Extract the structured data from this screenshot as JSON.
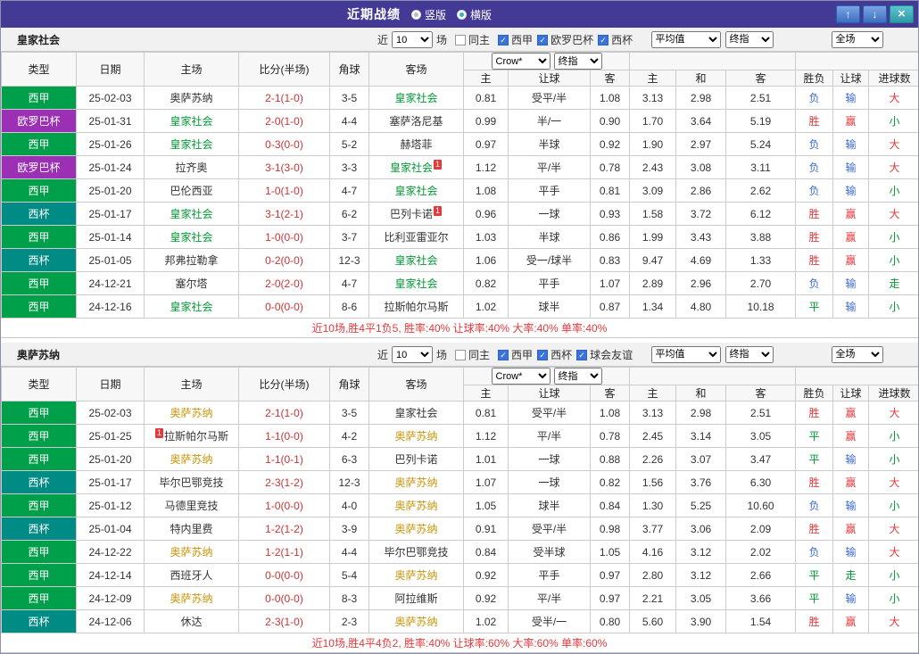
{
  "topbar": {
    "title": "近期战绩",
    "views": [
      {
        "label": "竖版",
        "selected": false
      },
      {
        "label": "横版",
        "selected": true
      }
    ],
    "up_button": "↑",
    "down_button": "↓",
    "close_button": "×",
    "bar_color": "#433a96"
  },
  "columns": {
    "type": "类型",
    "date": "日期",
    "home": "主场",
    "score": "比分(半场)",
    "corners": "角球",
    "away": "客场",
    "odds_home": "主",
    "odds_handicap": "让球",
    "odds_away": "客",
    "avg_home": "主",
    "avg_draw": "和",
    "avg_away": "客",
    "res_outcome": "胜负",
    "res_handicap": "让球",
    "res_goals": "进球数"
  },
  "league_colors": {
    "西甲": "#00a04a",
    "欧罗巴杯": "#9b30b5",
    "西杯": "#008b85"
  },
  "result_colors": {
    "胜": "#e4393c",
    "赢": "#e4393c",
    "大": "#e4393c",
    "负": "#3a6bd8",
    "输": "#3a6bd8",
    "平": "#009933",
    "走": "#009933",
    "小": "#009933"
  },
  "score_color": "#cc3333",
  "sections": [
    {
      "team": "皇家社会",
      "focal_color": "#009933",
      "filters": {
        "recent": "近",
        "count": "10",
        "games": "场",
        "same_home": "同主",
        "leagues": [
          "西甲",
          "欧罗巴杯",
          "西杯"
        ]
      },
      "selects": {
        "provider": "Crow*",
        "provider_final": "终指",
        "average": "平均值",
        "average_final": "终指",
        "scope": "全场"
      },
      "rows": [
        {
          "league": "西甲",
          "date": "25-02-03",
          "home": {
            "name": "奥萨苏纳"
          },
          "score": "2-1(1-0)",
          "corners": "3-5",
          "away": {
            "name": "皇家社会",
            "focal": true
          },
          "odds": [
            "0.81",
            "受平/半",
            "1.08"
          ],
          "avg": [
            "3.13",
            "2.98",
            "2.51"
          ],
          "results": [
            "负",
            "输",
            "大"
          ]
        },
        {
          "league": "欧罗巴杯",
          "date": "25-01-31",
          "home": {
            "name": "皇家社会",
            "focal": true
          },
          "score": "2-0(1-0)",
          "corners": "4-4",
          "away": {
            "name": "塞萨洛尼基"
          },
          "odds": [
            "0.99",
            "半/一",
            "0.90"
          ],
          "avg": [
            "1.70",
            "3.64",
            "5.19"
          ],
          "results": [
            "胜",
            "赢",
            "小"
          ]
        },
        {
          "league": "西甲",
          "date": "25-01-26",
          "home": {
            "name": "皇家社会",
            "focal": true
          },
          "score": "0-3(0-0)",
          "corners": "5-2",
          "away": {
            "name": "赫塔菲"
          },
          "odds": [
            "0.97",
            "半球",
            "0.92"
          ],
          "avg": [
            "1.90",
            "2.97",
            "5.24"
          ],
          "results": [
            "负",
            "输",
            "大"
          ]
        },
        {
          "league": "欧罗巴杯",
          "date": "25-01-24",
          "home": {
            "name": "拉齐奥"
          },
          "score": "3-1(3-0)",
          "corners": "3-3",
          "away": {
            "name": "皇家社会",
            "focal": true,
            "badge": "1",
            "badge_pos": "after"
          },
          "odds": [
            "1.12",
            "平/半",
            "0.78"
          ],
          "avg": [
            "2.43",
            "3.08",
            "3.11"
          ],
          "results": [
            "负",
            "输",
            "大"
          ]
        },
        {
          "league": "西甲",
          "date": "25-01-20",
          "home": {
            "name": "巴伦西亚"
          },
          "score": "1-0(1-0)",
          "corners": "4-7",
          "away": {
            "name": "皇家社会",
            "focal": true
          },
          "odds": [
            "1.08",
            "平手",
            "0.81"
          ],
          "avg": [
            "3.09",
            "2.86",
            "2.62"
          ],
          "results": [
            "负",
            "输",
            "小"
          ]
        },
        {
          "league": "西杯",
          "date": "25-01-17",
          "home": {
            "name": "皇家社会",
            "focal": true
          },
          "score": "3-1(2-1)",
          "corners": "6-2",
          "away": {
            "name": "巴列卡诺",
            "badge": "1",
            "badge_pos": "after"
          },
          "odds": [
            "0.96",
            "一球",
            "0.93"
          ],
          "avg": [
            "1.58",
            "3.72",
            "6.12"
          ],
          "results": [
            "胜",
            "赢",
            "大"
          ]
        },
        {
          "league": "西甲",
          "date": "25-01-14",
          "home": {
            "name": "皇家社会",
            "focal": true
          },
          "score": "1-0(0-0)",
          "corners": "3-7",
          "away": {
            "name": "比利亚雷亚尔"
          },
          "odds": [
            "1.03",
            "半球",
            "0.86"
          ],
          "avg": [
            "1.99",
            "3.43",
            "3.88"
          ],
          "results": [
            "胜",
            "赢",
            "小"
          ]
        },
        {
          "league": "西杯",
          "date": "25-01-05",
          "home": {
            "name": "邦弗拉勒拿"
          },
          "score": "0-2(0-0)",
          "corners": "12-3",
          "away": {
            "name": "皇家社会",
            "focal": true
          },
          "odds": [
            "1.06",
            "受一/球半",
            "0.83"
          ],
          "avg": [
            "9.47",
            "4.69",
            "1.33"
          ],
          "results": [
            "胜",
            "赢",
            "小"
          ]
        },
        {
          "league": "西甲",
          "date": "24-12-21",
          "home": {
            "name": "塞尔塔"
          },
          "score": "2-0(2-0)",
          "corners": "4-7",
          "away": {
            "name": "皇家社会",
            "focal": true
          },
          "odds": [
            "0.82",
            "平手",
            "1.07"
          ],
          "avg": [
            "2.89",
            "2.96",
            "2.70"
          ],
          "results": [
            "负",
            "输",
            "走"
          ]
        },
        {
          "league": "西甲",
          "date": "24-12-16",
          "home": {
            "name": "皇家社会",
            "focal": true
          },
          "score": "0-0(0-0)",
          "corners": "8-6",
          "away": {
            "name": "拉斯帕尔马斯"
          },
          "odds": [
            "1.02",
            "球半",
            "0.87"
          ],
          "avg": [
            "1.34",
            "4.80",
            "10.18"
          ],
          "results": [
            "平",
            "输",
            "小"
          ]
        }
      ],
      "summary": "近10场,胜4平1负5, 胜率:40% 让球率:40% 大率:40% 单率:40%"
    },
    {
      "team": "奥萨苏纳",
      "focal_color": "#c8960c",
      "filters": {
        "recent": "近",
        "count": "10",
        "games": "场",
        "same_home": "同主",
        "leagues": [
          "西甲",
          "西杯",
          "球会友谊"
        ]
      },
      "selects": {
        "provider": "Crow*",
        "provider_final": "终指",
        "average": "平均值",
        "average_final": "终指",
        "scope": "全场"
      },
      "rows": [
        {
          "league": "西甲",
          "date": "25-02-03",
          "home": {
            "name": "奥萨苏纳",
            "focal": true
          },
          "score": "2-1(1-0)",
          "corners": "3-5",
          "away": {
            "name": "皇家社会"
          },
          "odds": [
            "0.81",
            "受平/半",
            "1.08"
          ],
          "avg": [
            "3.13",
            "2.98",
            "2.51"
          ],
          "results": [
            "胜",
            "赢",
            "大"
          ]
        },
        {
          "league": "西甲",
          "date": "25-01-25",
          "home": {
            "name": "拉斯帕尔马斯",
            "badge": "1",
            "badge_pos": "before"
          },
          "score": "1-1(0-0)",
          "corners": "4-2",
          "away": {
            "name": "奥萨苏纳",
            "focal": true
          },
          "odds": [
            "1.12",
            "平/半",
            "0.78"
          ],
          "avg": [
            "2.45",
            "3.14",
            "3.05"
          ],
          "results": [
            "平",
            "赢",
            "小"
          ]
        },
        {
          "league": "西甲",
          "date": "25-01-20",
          "home": {
            "name": "奥萨苏纳",
            "focal": true
          },
          "score": "1-1(0-1)",
          "corners": "6-3",
          "away": {
            "name": "巴列卡诺"
          },
          "odds": [
            "1.01",
            "一球",
            "0.88"
          ],
          "avg": [
            "2.26",
            "3.07",
            "3.47"
          ],
          "results": [
            "平",
            "输",
            "小"
          ]
        },
        {
          "league": "西杯",
          "date": "25-01-17",
          "home": {
            "name": "毕尔巴鄂竞技"
          },
          "score": "2-3(1-2)",
          "corners": "12-3",
          "away": {
            "name": "奥萨苏纳",
            "focal": true
          },
          "odds": [
            "1.07",
            "一球",
            "0.82"
          ],
          "avg": [
            "1.56",
            "3.76",
            "6.30"
          ],
          "results": [
            "胜",
            "赢",
            "大"
          ]
        },
        {
          "league": "西甲",
          "date": "25-01-12",
          "home": {
            "name": "马德里竞技"
          },
          "score": "1-0(0-0)",
          "corners": "4-0",
          "away": {
            "name": "奥萨苏纳",
            "focal": true
          },
          "odds": [
            "1.05",
            "球半",
            "0.84"
          ],
          "avg": [
            "1.30",
            "5.25",
            "10.60"
          ],
          "results": [
            "负",
            "输",
            "小"
          ]
        },
        {
          "league": "西杯",
          "date": "25-01-04",
          "home": {
            "name": "特内里费"
          },
          "score": "1-2(1-2)",
          "corners": "3-9",
          "away": {
            "name": "奥萨苏纳",
            "focal": true
          },
          "odds": [
            "0.91",
            "受平/半",
            "0.98"
          ],
          "avg": [
            "3.77",
            "3.06",
            "2.09"
          ],
          "results": [
            "胜",
            "赢",
            "大"
          ]
        },
        {
          "league": "西甲",
          "date": "24-12-22",
          "home": {
            "name": "奥萨苏纳",
            "focal": true
          },
          "score": "1-2(1-1)",
          "corners": "4-4",
          "away": {
            "name": "毕尔巴鄂竞技"
          },
          "odds": [
            "0.84",
            "受半球",
            "1.05"
          ],
          "avg": [
            "4.16",
            "3.12",
            "2.02"
          ],
          "results": [
            "负",
            "输",
            "大"
          ]
        },
        {
          "league": "西甲",
          "date": "24-12-14",
          "home": {
            "name": "西班牙人"
          },
          "score": "0-0(0-0)",
          "corners": "5-4",
          "away": {
            "name": "奥萨苏纳",
            "focal": true
          },
          "odds": [
            "0.92",
            "平手",
            "0.97"
          ],
          "avg": [
            "2.80",
            "3.12",
            "2.66"
          ],
          "results": [
            "平",
            "走",
            "小"
          ]
        },
        {
          "league": "西甲",
          "date": "24-12-09",
          "home": {
            "name": "奥萨苏纳",
            "focal": true
          },
          "score": "0-0(0-0)",
          "corners": "8-3",
          "away": {
            "name": "阿拉维斯"
          },
          "odds": [
            "0.92",
            "平/半",
            "0.97"
          ],
          "avg": [
            "2.21",
            "3.05",
            "3.66"
          ],
          "results": [
            "平",
            "输",
            "小"
          ]
        },
        {
          "league": "西杯",
          "date": "24-12-06",
          "home": {
            "name": "休达"
          },
          "score": "2-3(1-0)",
          "corners": "2-3",
          "away": {
            "name": "奥萨苏纳",
            "focal": true
          },
          "odds": [
            "1.02",
            "受半/一",
            "0.80"
          ],
          "avg": [
            "5.60",
            "3.90",
            "1.54"
          ],
          "results": [
            "胜",
            "赢",
            "大"
          ]
        }
      ],
      "summary": "近10场,胜4平4负2, 胜率:40% 让球率:60% 大率:60% 单率:60%"
    }
  ]
}
